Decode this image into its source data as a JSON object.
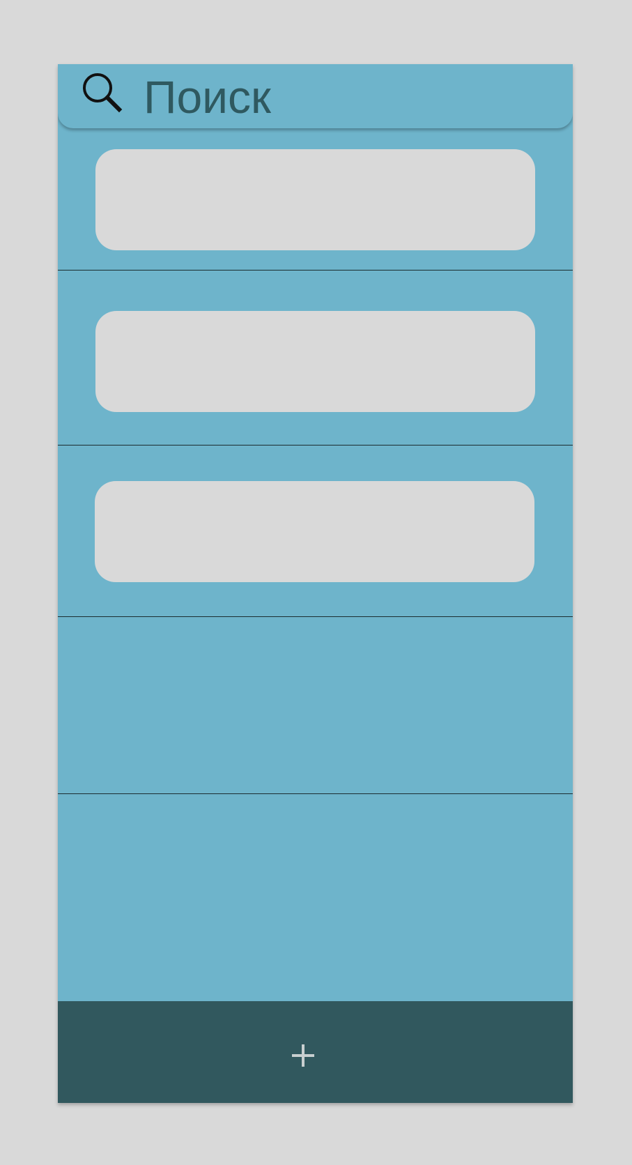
{
  "colors": {
    "page_background": "#d9d9d9",
    "panel": "#6eb4cb",
    "card": "#d9d9d9",
    "divider": "#1b2c30",
    "search_text": "#2f5960",
    "footer": "#31585e",
    "add_icon": "#c8cfd0"
  },
  "search": {
    "icon": "search-icon",
    "placeholder": "Поиск"
  },
  "list": {
    "rows": [
      {
        "has_card": true
      },
      {
        "has_card": true
      },
      {
        "has_card": true
      },
      {
        "has_card": false
      },
      {
        "has_card": false
      }
    ]
  },
  "footer": {
    "add_icon": "plus-icon"
  }
}
